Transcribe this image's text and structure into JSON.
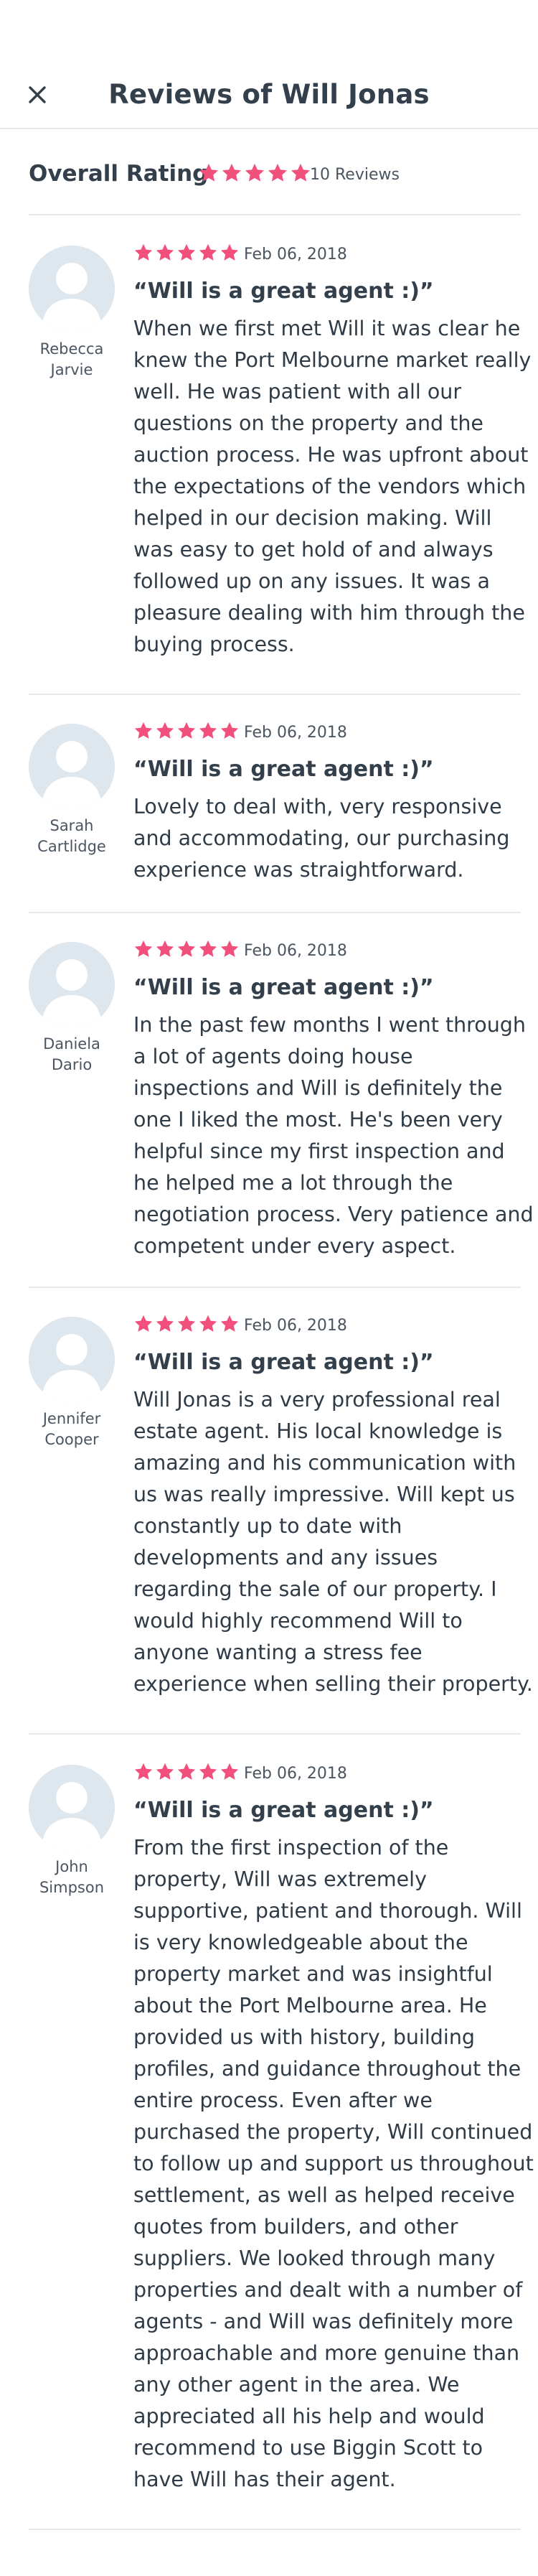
{
  "header": {
    "title": "Reviews of Will Jonas"
  },
  "overall": {
    "label": "Overall Rating",
    "rating_stars": 5,
    "count_text": "10 Reviews"
  },
  "colors": {
    "star": "#f0507b",
    "avatar_bg": "#dfe7ee",
    "divider": "#e6e9ec"
  },
  "reviews": [
    {
      "author": "Rebecca Jarvie",
      "stars": 5,
      "date": "Feb 06, 2018",
      "title": "“Will is a great agent :)”",
      "body": "When we first met Will it was clear he knew the Port Melbourne market really well. He was patient with all our questions on the property and the auction process. He was upfront about the expectations of the vendors which helped in our decision making. Will was easy to get hold of and always followed up on any issues. It was a pleasure dealing with him through the buying process."
    },
    {
      "author": "Sarah Cartlidge",
      "stars": 5,
      "date": "Feb 06, 2018",
      "title": "“Will is a great agent :)”",
      "body": "Lovely to deal with, very responsive and accommodating, our purchasing experience was straightforward."
    },
    {
      "author": "Daniela Dario",
      "stars": 5,
      "date": "Feb 06, 2018",
      "title": "“Will is a great agent :)”",
      "body": "In the past few months I went through a lot of agents doing house inspections and Will is definitely the one I liked the most. He's been very helpful since my first inspection and he helped me a lot through the negotiation process. Very patience and competent under every aspect."
    },
    {
      "author": "Jennifer Cooper",
      "stars": 5,
      "date": "Feb 06, 2018",
      "title": "“Will is a great agent :)”",
      "body": "Will Jonas is a very professional real estate agent. His local knowledge is amazing and his communication with us was really impressive. Will kept us constantly up to date with developments and any issues regarding the sale of our property. I would highly recommend Will to anyone wanting a stress fee experience when selling their property."
    },
    {
      "author": "John Simpson",
      "stars": 5,
      "date": "Feb 06, 2018",
      "title": "“Will is a great agent :)”",
      "body": "From the first inspection of the property, Will was extremely supportive, patient and thorough. Will is very knowledgeable about the property market and was insightful about the Port Melbourne area. He provided us with history, building profiles, and guidance throughout the entire process. Even after we purchased the property, Will continued to follow up and support us throughout settlement, as well as helped receive quotes from builders, and other suppliers. We looked through many properties and dealt with a number of agents - and Will was definitely more approachable and more genuine than any other agent in the area. We appreciated all his help and would recommend to use Biggin Scott to have Will has their agent."
    }
  ]
}
